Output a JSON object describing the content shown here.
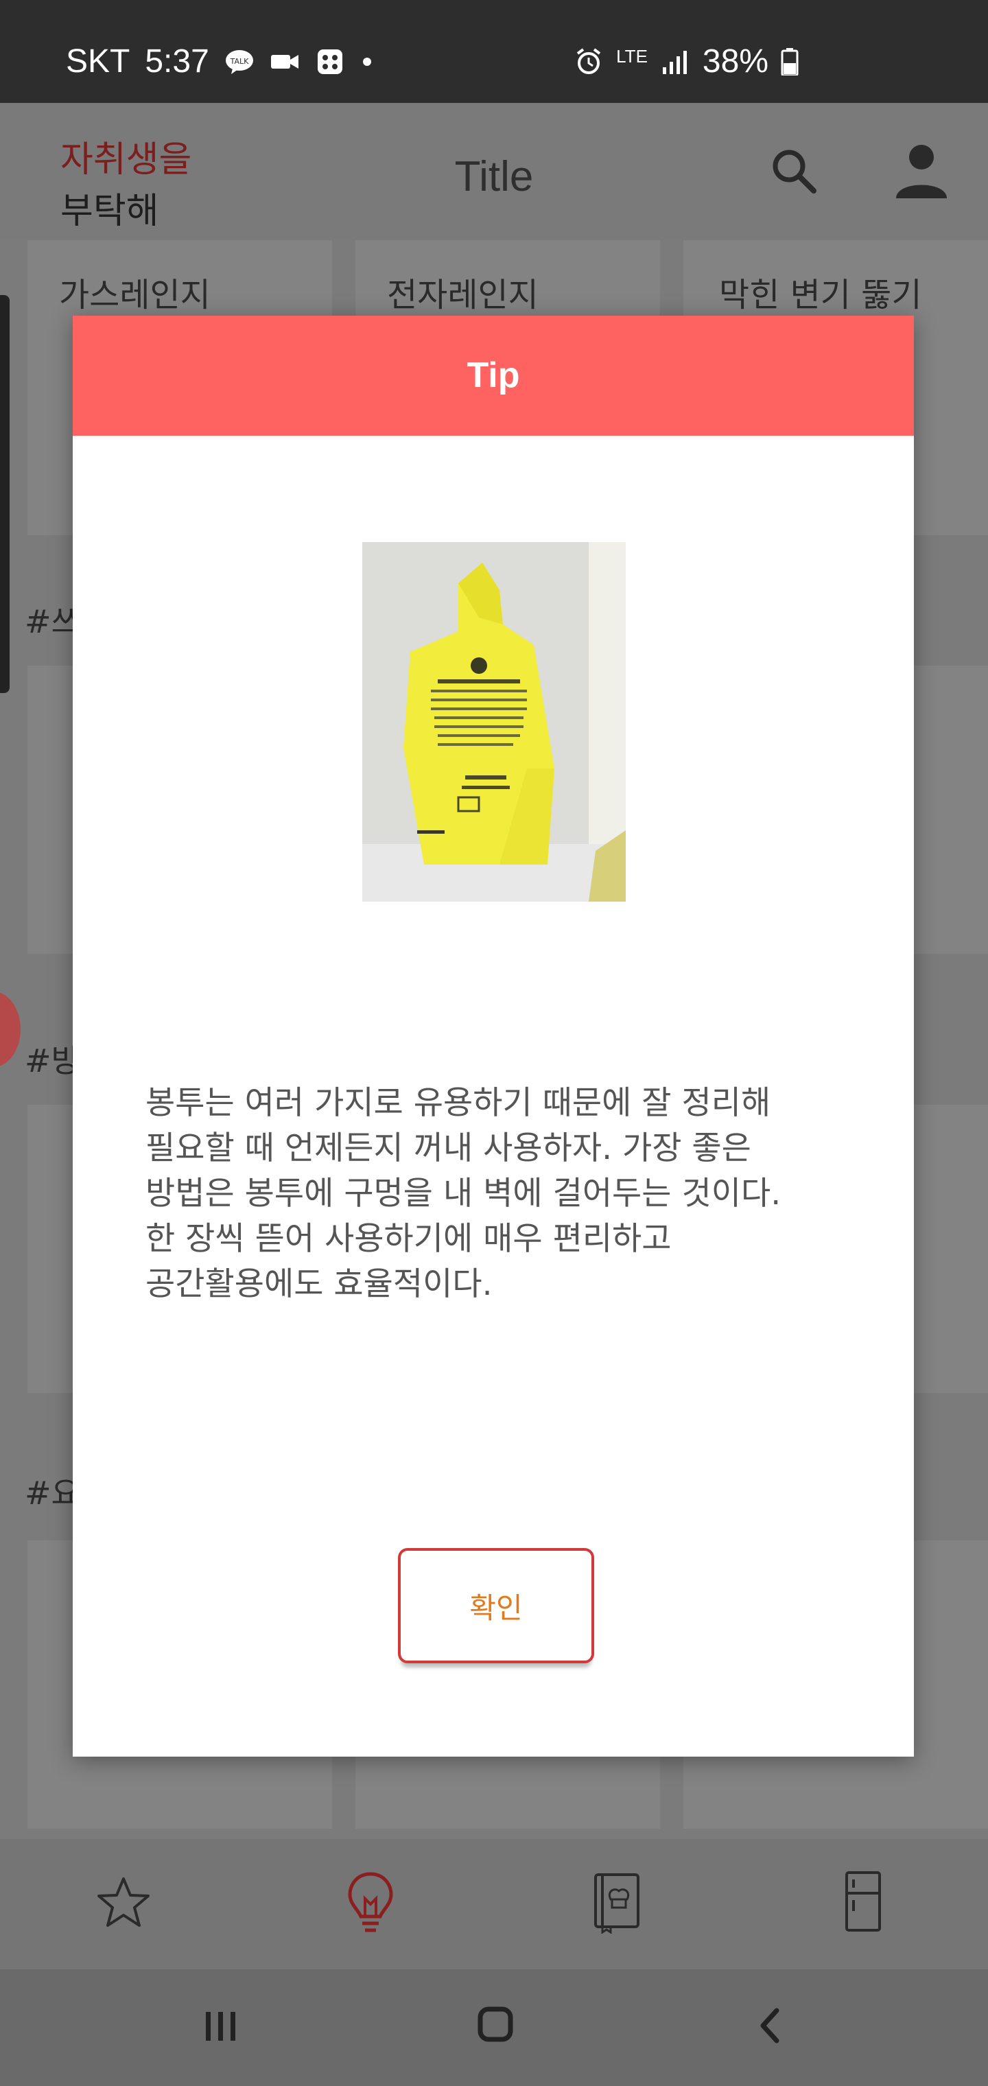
{
  "status_bar": {
    "carrier": "SKT",
    "time": "5:37",
    "network": "LTE",
    "battery": "38%",
    "icons": [
      "kakaotalk-icon",
      "video-icon",
      "game-icon",
      "dot-icon",
      "alarm-icon",
      "signal-icon",
      "battery-icon"
    ]
  },
  "app_bar": {
    "logo_line1": "자취생을",
    "logo_line2": "부탁해",
    "title": "Title",
    "icons": [
      "search-icon",
      "account-icon"
    ]
  },
  "background": {
    "cards_row1": [
      "가스레인지",
      "전자레인지",
      "막힌 변기 뚫기"
    ],
    "sections": [
      "#쓰",
      "#방",
      "#요"
    ]
  },
  "dialog": {
    "header": "Tip",
    "photo": "hanging-yellow-bag-photo",
    "body": "봉투는 여러 가지로 유용하기 때문에 잘 정리해\n필요할 때 언제든지 꺼내 사용하자. 가장 좋은\n방법은 봉투에 구멍을 내 벽에 걸어두는 것이다.\n한 장씩 뜯어 사용하기에 매우 편리하고\n공간활용에도 효율적이다.",
    "confirm_label": "확인"
  },
  "bottom_nav": {
    "items": [
      "star-icon",
      "lightbulb-icon",
      "recipe-book-icon",
      "fridge-icon"
    ],
    "active_color": "#c0392b"
  },
  "system_nav": [
    "recents-icon",
    "home-icon",
    "back-icon"
  ],
  "colors": {
    "header": "#ff6361",
    "button_border": "#d23a3a",
    "button_text": "#e07a1a"
  }
}
